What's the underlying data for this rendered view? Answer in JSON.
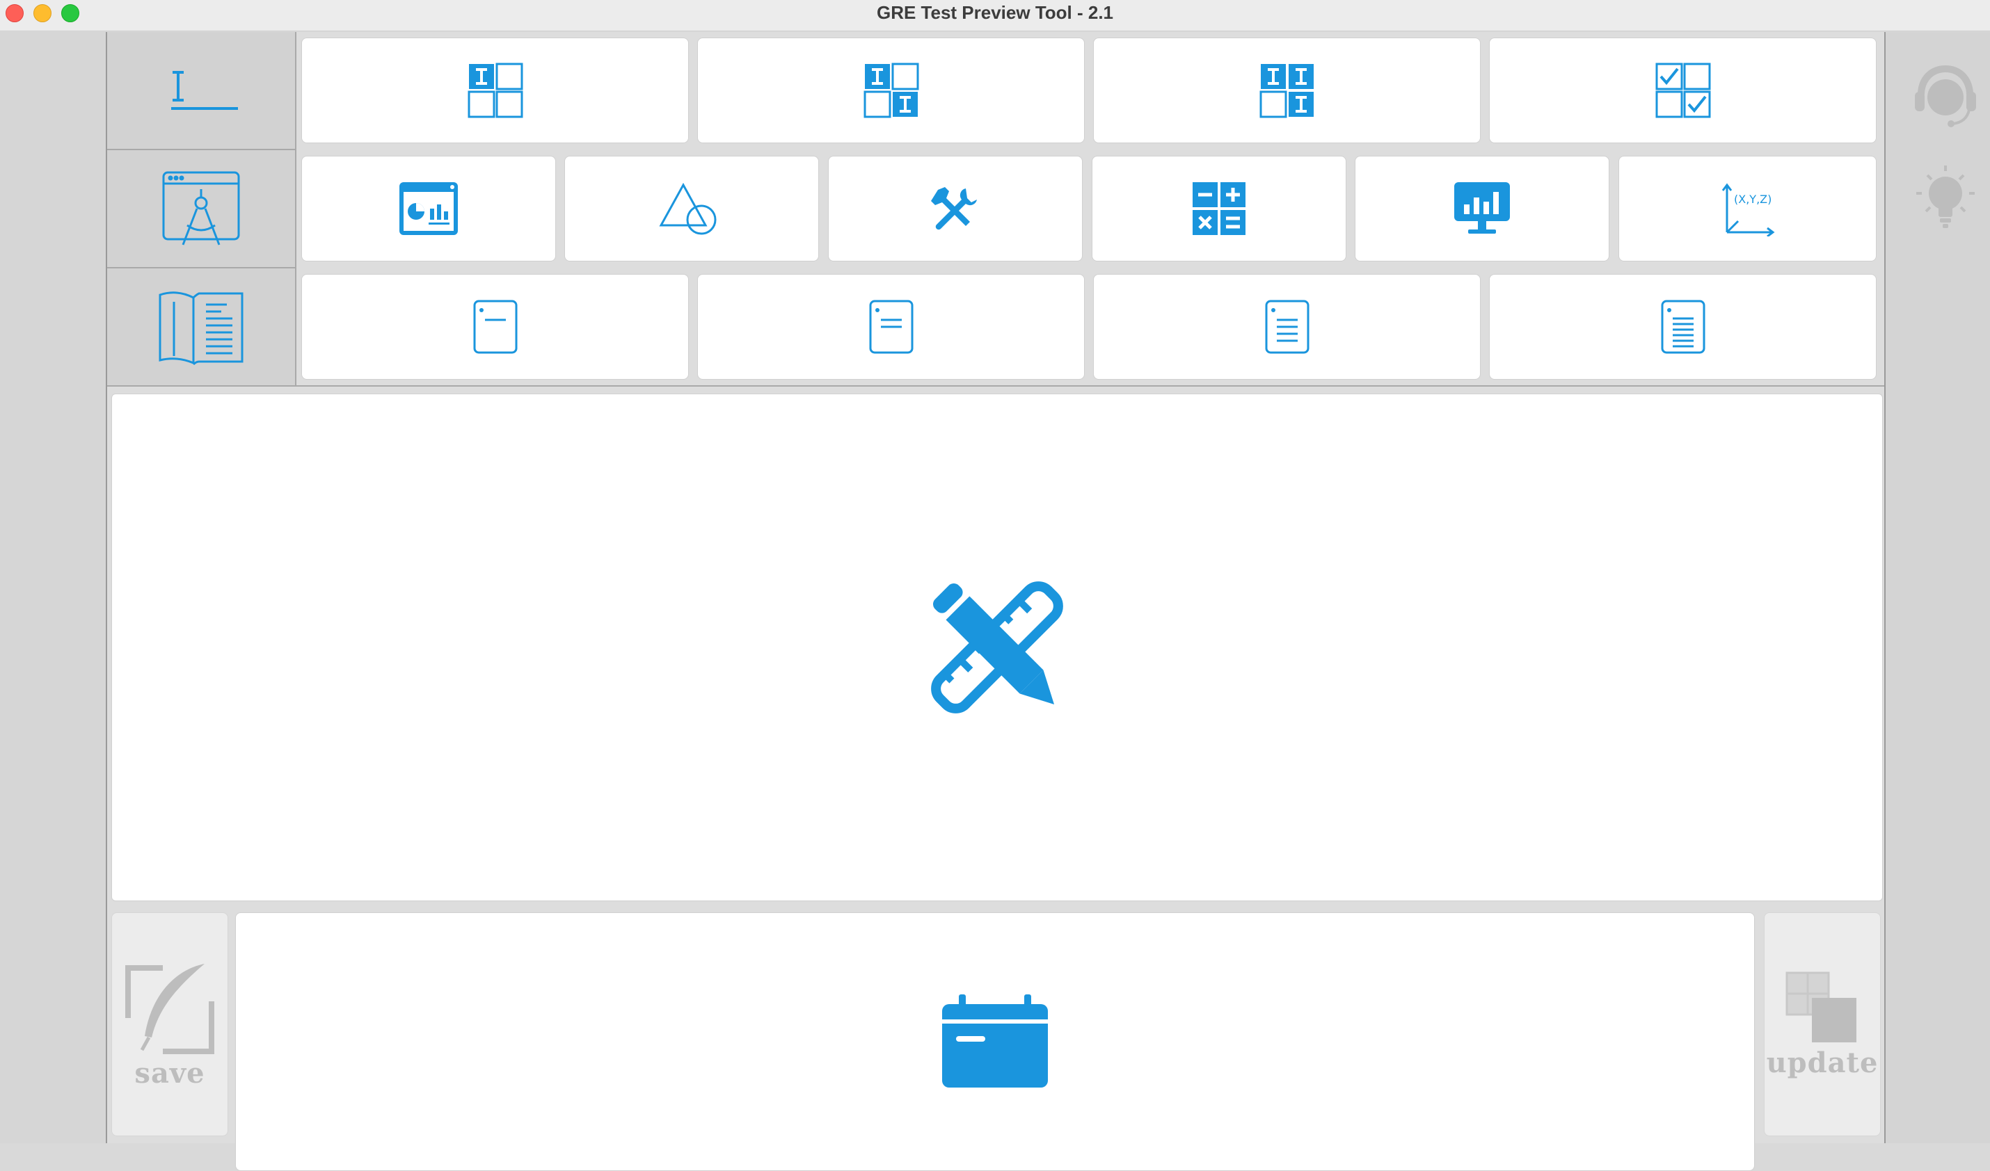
{
  "window": {
    "title": "GRE Test Preview Tool - 2.1"
  },
  "rows": [
    {
      "header_icon": "text-entry-icon",
      "items": [
        "one-blank-grid-icon",
        "two-blank-grid-icon",
        "three-blank-grid-icon",
        "sentence-equivalence-icon"
      ]
    },
    {
      "header_icon": "geometry-compass-icon",
      "items": [
        "data-dashboard-icon",
        "shapes-icon",
        "tools-icon",
        "calculator-icon",
        "presentation-chart-icon",
        "coordinate-axes-icon"
      ]
    },
    {
      "header_icon": "open-book-icon",
      "items": [
        "short-passage-icon",
        "medium-passage-icon",
        "long-passage-icon",
        "extra-long-passage-icon"
      ]
    }
  ],
  "canvas": {
    "icon": "pencil-ruler-icon"
  },
  "bottom": {
    "save_label": "save",
    "update_label": "update",
    "center_icon": "calendar-icon"
  },
  "side": {
    "icons": [
      "support-agent-icon",
      "lightbulb-icon"
    ]
  },
  "colors": {
    "accent": "#1a95dd",
    "disabled": "#bdbdbd"
  }
}
